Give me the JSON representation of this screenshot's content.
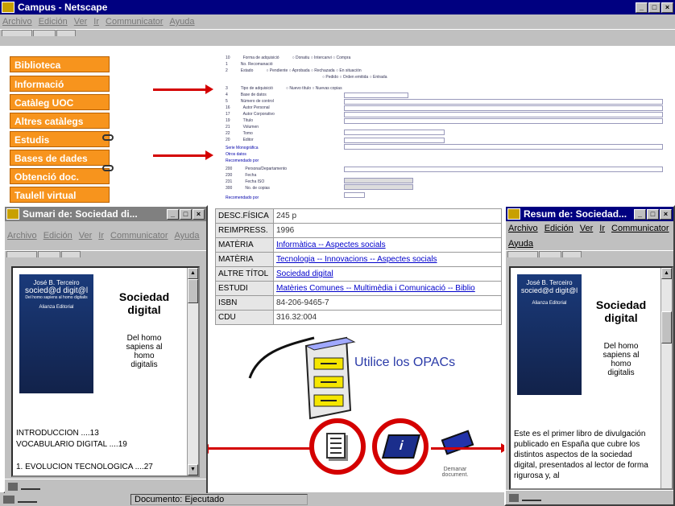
{
  "main": {
    "title": "Campus - Netscape",
    "menus": [
      "Archivo",
      "Edición",
      "Ver",
      "Ir",
      "Communicator",
      "Ayuda"
    ],
    "status": "Documento: Ejecutado"
  },
  "nav": [
    "Biblioteca",
    "Informació",
    "Catàleg UOC",
    "Altres catàlegs",
    "Estudis",
    "Bases de dades",
    "Obtenció doc.",
    "Taulell virtual"
  ],
  "record": [
    {
      "k": "DESC.FÍSICA",
      "v": "245 p",
      "link": false
    },
    {
      "k": "REIMPRESS.",
      "v": "1996",
      "link": false
    },
    {
      "k": "MATÈRIA",
      "v": "Informàtica -- Aspectes socials",
      "link": true
    },
    {
      "k": "MATÈRIA",
      "v": "Tecnologia -- Innovacions -- Aspectes socials",
      "link": true
    },
    {
      "k": "ALTRE TÍTOL",
      "v": "Sociedad digital",
      "link": true
    },
    {
      "k": "ESTUDI",
      "v": "Matèries Comunes -- Multimèdia i Comunicació -- Biblio",
      "link": true
    },
    {
      "k": "ISBN",
      "v": "84-206-9465-7",
      "link": false
    },
    {
      "k": "CDU",
      "v": "316.32:004",
      "link": false
    }
  ],
  "left_window": {
    "title": "Sumari de: Sociedad di...",
    "menus": [
      "Archivo",
      "Edición",
      "Ver",
      "Ir",
      "Communicator",
      "Ayuda"
    ],
    "book_author": "José B. Terceiro",
    "book_title": "socied@d digit@l",
    "book_sub": "Del homo sapiens al homo digitalis",
    "book_pub": "Alianza Editorial",
    "heading": "Sociedad digital",
    "subhead": "Del homo sapiens al homo digitalis",
    "toc": [
      "INTRODUCCION ....13",
      "VOCABULARIO DIGITAL ....19",
      "1. EVOLUCION TECNOLOGICA ....27"
    ]
  },
  "right_window": {
    "title": "Resum de: Sociedad...",
    "menus": [
      "Archivo",
      "Edición",
      "Ver",
      "Ir",
      "Communicator",
      "Ayuda"
    ],
    "heading": "Sociedad digital",
    "subhead": "Del homo sapiens al homo digitalis",
    "summary": "Este es el primer libro de divulgación publicado en España que cubre los distintos aspectos de la sociedad digital, presentados al lector de forma rigurosa y, al"
  },
  "opac_label": "Utilice los OPACs",
  "demanar": "Demanar document.",
  "colors": {
    "nav": "#f7941d",
    "arrow": "#d40000",
    "titlebar_active": "#000080"
  }
}
